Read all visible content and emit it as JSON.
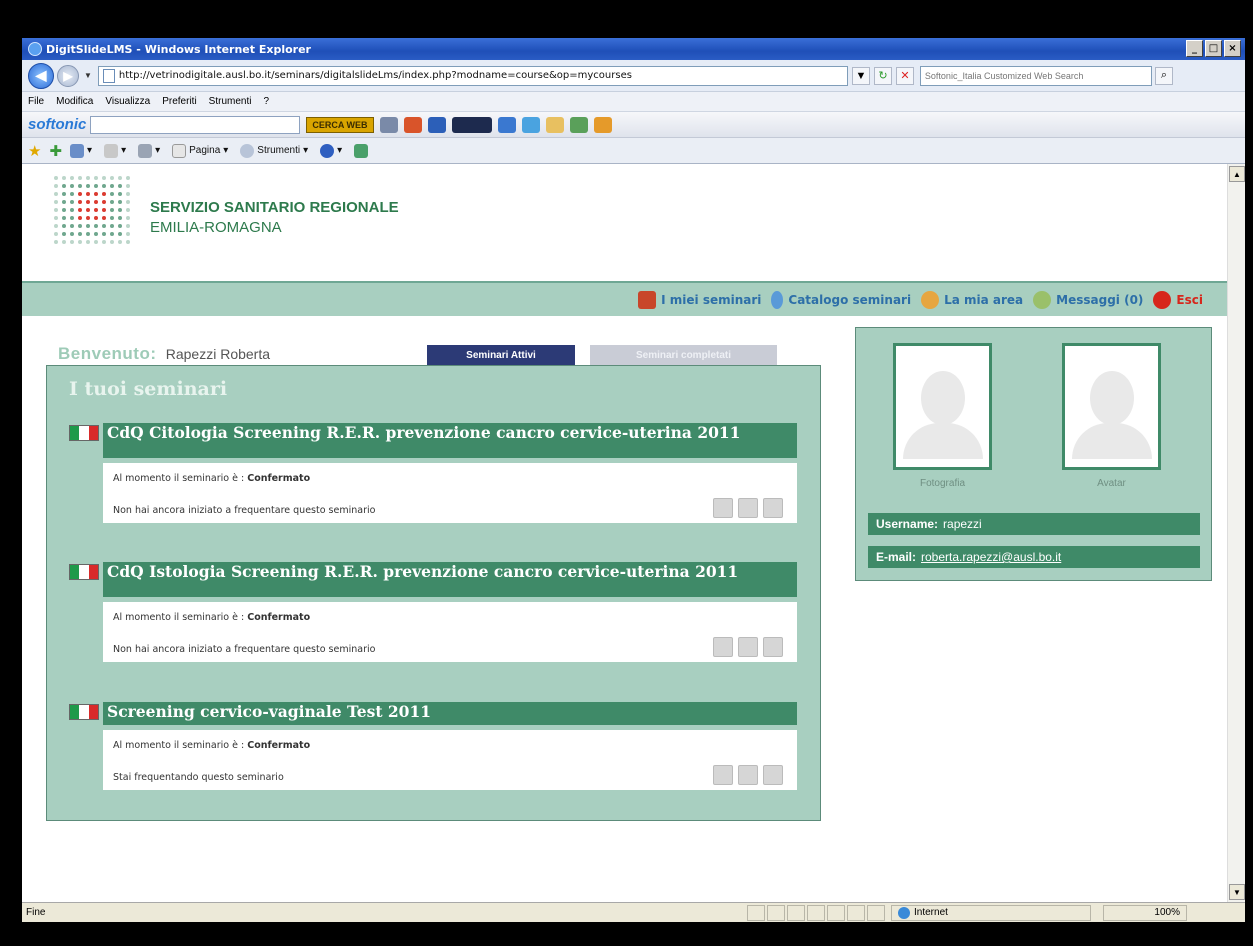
{
  "window": {
    "title": "DigitSlideLMS - Windows Internet Explorer",
    "controls": [
      "_",
      "□",
      "×"
    ]
  },
  "addressbar": {
    "url": "http://vetrinodigitale.ausl.bo.it/seminars/digitalslideLms/index.php?modname=course&op=mycourses",
    "search_placeholder": "Softonic_Italia Customized Web Search"
  },
  "menu": [
    "File",
    "Modifica",
    "Visualizza",
    "Preferiti",
    "Strumenti",
    "?"
  ],
  "softonic": {
    "logo": "softonic",
    "search_button": "CERCA WEB"
  },
  "commandbar": {
    "page": "Pagina",
    "tools": "Strumenti"
  },
  "org": {
    "line1": "SERVIZIO SANITARIO REGIONALE",
    "line2": "EMILIA-ROMAGNA",
    "colors": {
      "green": "#3f8a68",
      "red": "#d7261b"
    }
  },
  "topnav": [
    {
      "label": "I miei seminari",
      "icon": "home-icon"
    },
    {
      "label": "Catalogo seminari",
      "icon": "catalog-icon"
    },
    {
      "label": "La mia area",
      "icon": "user-area-icon"
    },
    {
      "label": "Messaggi (0)",
      "icon": "messages-icon"
    },
    {
      "label": "Esci",
      "icon": "exit-icon"
    }
  ],
  "welcome": {
    "label": "Benvenuto:",
    "user": "Rapezzi Roberta"
  },
  "tabs": {
    "active": "Seminari Attivi",
    "completed": "Seminari completati"
  },
  "panel_title": "I tuoi seminari",
  "seminars": [
    {
      "title": "CdQ Citologia Screening R.E.R. prevenzione cancro cervice-uterina 2011",
      "status_label": "Al momento il seminario è :",
      "status_value": "Confermato",
      "progress": "Non hai ancora iniziato a frequentare questo seminario"
    },
    {
      "title": "CdQ Istologia Screening R.E.R. prevenzione cancro cervice-uterina 2011",
      "status_label": "Al momento il seminario è :",
      "status_value": "Confermato",
      "progress": "Non hai ancora iniziato a frequentare questo seminario"
    },
    {
      "title": "Screening cervico-vaginale Test 2011",
      "status_label": "Al momento il seminario è :",
      "status_value": "Confermato",
      "progress": "Stai frequentando questo seminario"
    }
  ],
  "profile": {
    "photo_label": "Fotografia",
    "avatar_label": "Avatar",
    "username_label": "Username:",
    "username": "rapezzi",
    "email_label": "E-mail:",
    "email": "roberta.rapezzi@ausl.bo.it"
  },
  "statusbar": {
    "text": "Fine",
    "zone": "Internet",
    "zoom": "100%"
  }
}
